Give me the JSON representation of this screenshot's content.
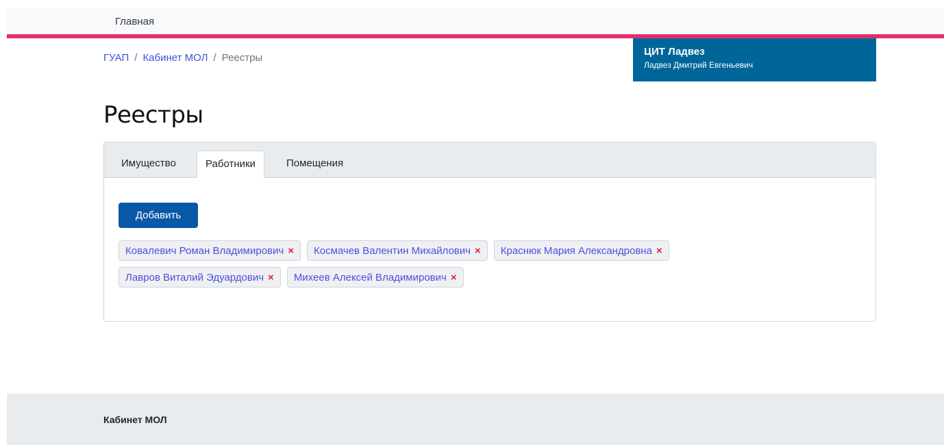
{
  "nav": {
    "home_label": "Главная"
  },
  "breadcrumb": {
    "items": [
      "ГУАП",
      "Кабинет МОЛ",
      "Реестры"
    ],
    "separator": "/"
  },
  "user": {
    "org": "ЦИТ Ладвез",
    "name": "Ладвез Дмитрий Евгеньевич"
  },
  "page": {
    "title": "Реестры"
  },
  "tabs": [
    {
      "label": "Имущество",
      "active": false
    },
    {
      "label": "Работники",
      "active": true
    },
    {
      "label": "Помещения",
      "active": false
    }
  ],
  "actions": {
    "add_label": "Добавить"
  },
  "workers": [
    "Ковалевич Роман Владимирович",
    "Космачев Валентин Михайлович",
    "Краснюк Мария Александровна",
    "Лавров Виталий Эдуардович",
    "Михеев Алексей Владимирович"
  ],
  "chip_remove_symbol": "×",
  "footer": {
    "title": "Кабинет МОЛ"
  },
  "colors": {
    "accent": "#e0306a",
    "user_box": "#006699",
    "primary_button": "#0a58a8",
    "link": "#3f51d8",
    "remove": "#e0203a"
  }
}
